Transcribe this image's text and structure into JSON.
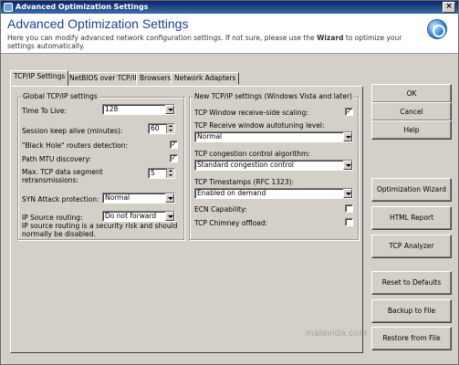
{
  "window": {
    "title": "Advanced Optimization Settings"
  },
  "header": {
    "title": "Advanced Optimization Settings",
    "description_pre": "Here you can modify advanced network configuration settings. If not sure, please use the ",
    "description_bold": "Wizard",
    "description_post": " to optimize your settings automatically."
  },
  "tabs": [
    "TCP/IP Settings",
    "NetBIOS over TCP/IP",
    "Browsers",
    "Network Adapters"
  ],
  "global": {
    "group_title": "Global TCP/IP settings",
    "ttl_label": "Time To Live:",
    "ttl_value": "128",
    "keepalive_label": "Session keep alive (minutes):",
    "keepalive_value": "60",
    "blackhole_label": "\"Black Hole\" routers detection:",
    "pmtu_label": "Path MTU discovery:",
    "retrans_label_1": "Max. TCP data segment",
    "retrans_label_2": "retransmissions:",
    "retrans_value": "5",
    "syn_label": "SYN Attack protection:",
    "syn_value": "Normal",
    "iprouting_label": "IP Source routing:",
    "iprouting_value": "Do not forward",
    "iprouting_note": "IP source routing is a security risk and should normally be disabled."
  },
  "vista": {
    "group_title": "New TCP/IP settings (Windows Vista and later)",
    "rss_label": "TCP Window receive-side scaling:",
    "autotune_label": "TCP Receive window autotuning level:",
    "autotune_value": "Normal",
    "congestion_label": "TCP congestion control algorithm:",
    "congestion_value": "Standard congestion control",
    "timestamps_label": "TCP Timestamps (RFC 1323):",
    "timestamps_value": "Enabled on demand",
    "ecn_label": "ECN Capability:",
    "chimney_label": "TCP Chimney offload:"
  },
  "checkmark": "✓",
  "buttons": {
    "ok": "OK",
    "cancel": "Cancel",
    "help": "Help",
    "wizard": "Optimization Wizard",
    "html_report": "HTML Report",
    "tcp_analyzer": "TCP Analyzer",
    "reset": "Reset to Defaults",
    "backup": "Backup to File",
    "restore": "Restore from File"
  },
  "watermark": "malavida.com"
}
